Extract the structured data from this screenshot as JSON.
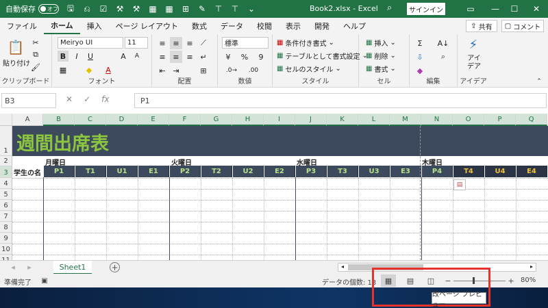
{
  "titlebar": {
    "autosave_label": "自動保存",
    "autosave_state": "オフ",
    "doc_title": "Book2.xlsx  -  Excel",
    "signin_label": "サインイン"
  },
  "ribbon_tabs": [
    "ファイル",
    "ホーム",
    "挿入",
    "ページ レイアウト",
    "数式",
    "データ",
    "校閲",
    "表示",
    "開発",
    "ヘルプ"
  ],
  "share_label": "共有",
  "comment_label": "コメント",
  "ribbon": {
    "paste_label": "貼り付け",
    "clipboard_group": "クリップボード",
    "font_name": "Meiryo UI",
    "font_size": "11",
    "font_group": "フォント",
    "align_group": "配置",
    "number_format": "標準",
    "number_group": "数値",
    "cond_format": "条件付き書式",
    "table_format": "テーブルとして書式設定",
    "cell_style": "セルのスタイル",
    "style_group": "スタイル",
    "insert_label": "挿入",
    "delete_label": "削除",
    "format_label": "書式",
    "cells_group": "セル",
    "editing_group": "編集",
    "ideas_label": "アイ デア",
    "ideas_group": "アイデア"
  },
  "formula_bar": {
    "name_box": "B3",
    "formula": "P1"
  },
  "grid": {
    "columns": [
      "A",
      "B",
      "C",
      "D",
      "E",
      "F",
      "G",
      "H",
      "I",
      "J",
      "K",
      "L",
      "M",
      "N",
      "O",
      "P",
      "Q"
    ],
    "rows": [
      "1",
      "2",
      "3",
      "4",
      "5",
      "6",
      "7",
      "8",
      "9",
      "10",
      "11"
    ],
    "title": "週間出席表",
    "days": [
      "月曜日",
      "火曜日",
      "水曜日",
      "木曜日"
    ],
    "a3_label": "学生の名",
    "headers": [
      "P1",
      "T1",
      "U1",
      "E1",
      "P2",
      "T2",
      "U2",
      "E2",
      "P3",
      "T3",
      "U3",
      "E3",
      "P4",
      "T4",
      "U4",
      "E4"
    ]
  },
  "sheet_tab": "Sheet1",
  "status": {
    "ready": "準備完了",
    "count_label": "データの個数: 13",
    "zoom": "80%"
  },
  "tooltip": "改ページ プレビュー",
  "colors": {
    "excel_green": "#217346",
    "title_band": "#3d4a5e",
    "title_text": "#8cc63e",
    "highlight": "#e8332a"
  }
}
